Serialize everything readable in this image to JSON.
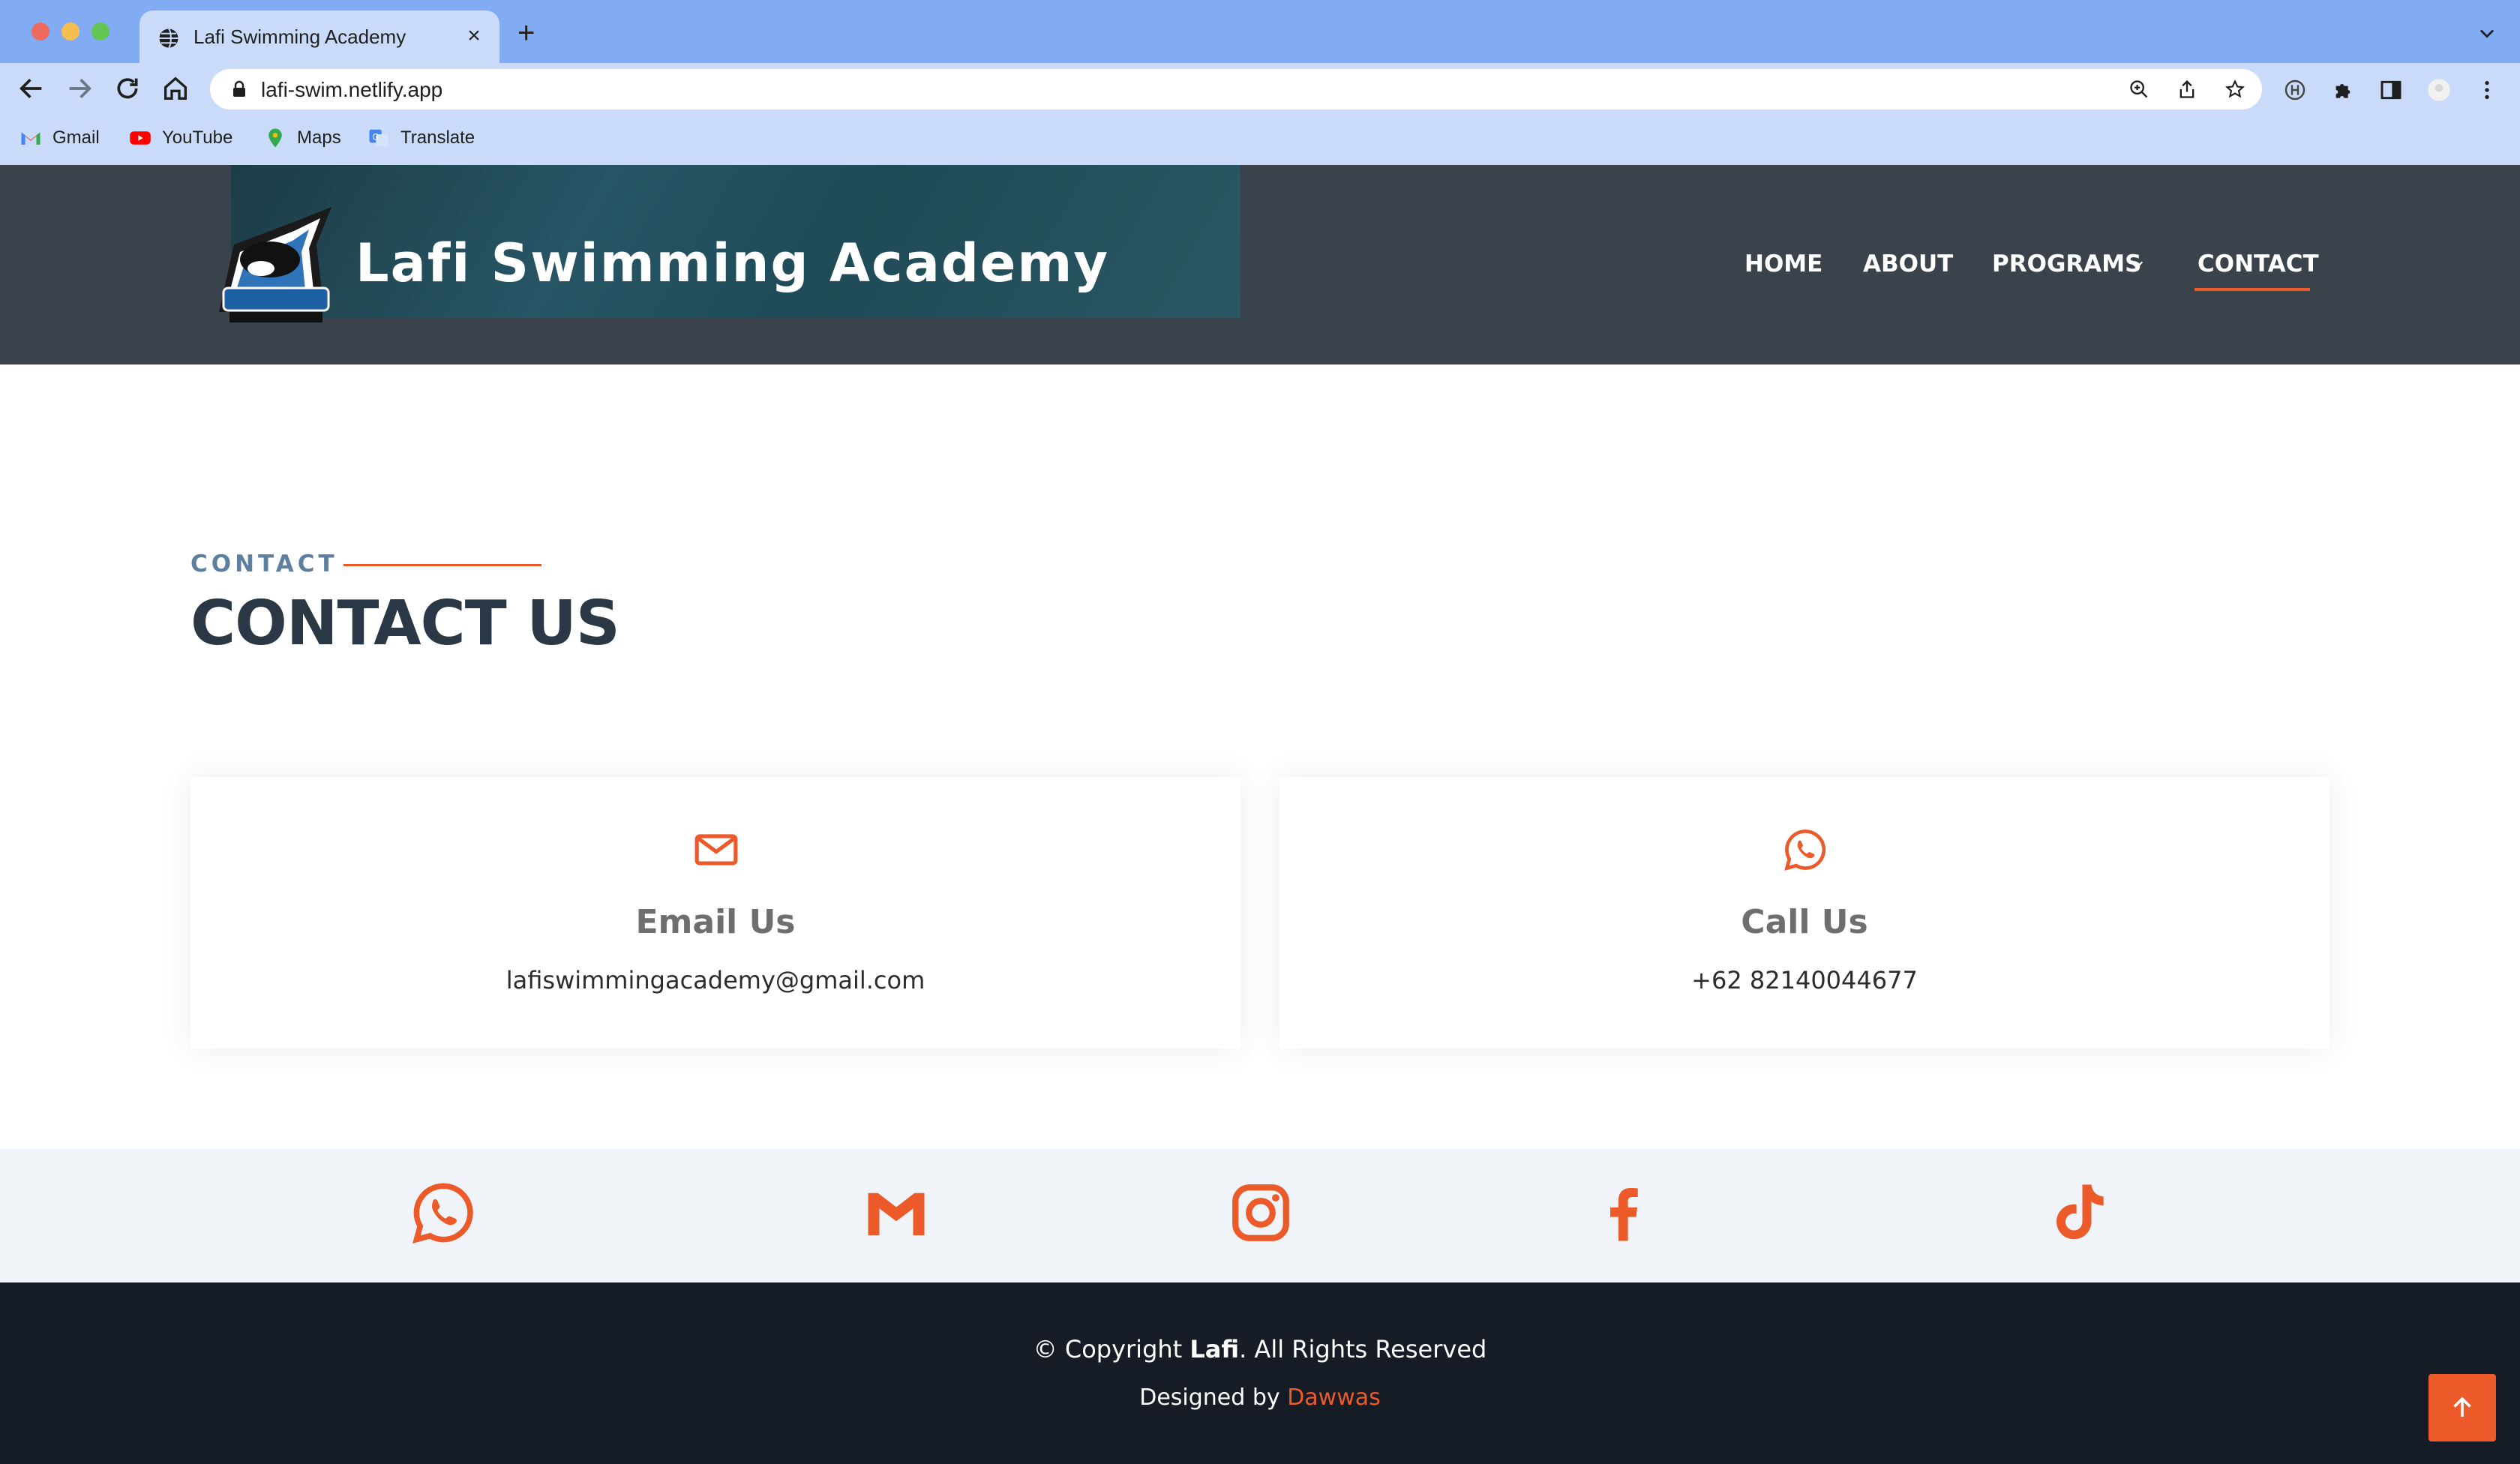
{
  "browser": {
    "tab_title": "Lafi Swimming Academy",
    "tab_close": "×",
    "new_tab": "+",
    "url": "lafi-swim.netlify.app",
    "bookmarks": [
      {
        "label": "Gmail",
        "icon": "gmail-icon"
      },
      {
        "label": "YouTube",
        "icon": "youtube-icon"
      },
      {
        "label": "Maps",
        "icon": "maps-icon"
      },
      {
        "label": "Translate",
        "icon": "translate-icon"
      }
    ]
  },
  "header": {
    "brand": "Lafi Swimming Academy",
    "nav": [
      {
        "label": "HOME",
        "active": false
      },
      {
        "label": "ABOUT",
        "active": false
      },
      {
        "label": "PROGRAMS",
        "active": false,
        "dropdown": true
      },
      {
        "label": "CONTACT",
        "active": true
      }
    ]
  },
  "contact": {
    "tag": "CONTACT",
    "title": "CONTACT US",
    "cards": [
      {
        "heading": "Email Us",
        "value": "lafiswimmingacademy@gmail.com",
        "icon": "envelope-icon"
      },
      {
        "heading": "Call Us",
        "value": "+62 82140044677",
        "icon": "whatsapp-icon"
      }
    ]
  },
  "social": [
    "whatsapp-icon",
    "gmail-icon",
    "instagram-icon",
    "facebook-icon",
    "tiktok-icon"
  ],
  "footer": {
    "copyright_prefix": "© Copyright",
    "copyright_brand": "Lafi",
    "copyright_suffix": ". All Rights Reserved",
    "designed_prefix": "Designed by",
    "designer": "Dawwas"
  },
  "colors": {
    "accent": "#ec5a2a",
    "header_bg": "#3a424c",
    "footer_bg": "#151c25",
    "title": "#2a3846",
    "tag": "#5d7fa0",
    "tabstrip": "#81acf4",
    "toolbar": "#c9dbf8"
  }
}
